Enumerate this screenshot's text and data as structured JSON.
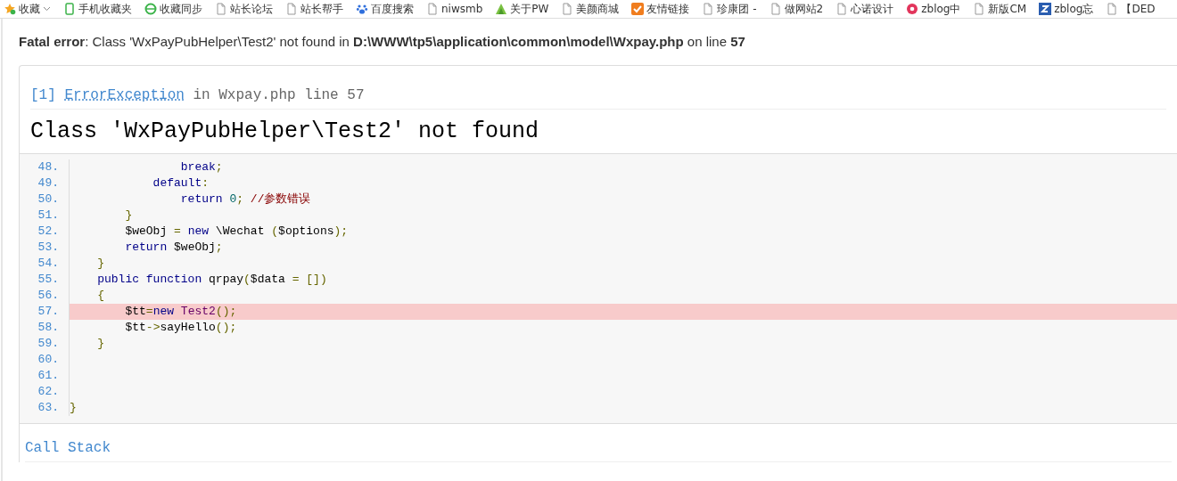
{
  "bookmarks": [
    {
      "kind": "star",
      "label": "收藏",
      "dropdown": true
    },
    {
      "kind": "phone",
      "label": "手机收藏夹",
      "dropdown": false
    },
    {
      "kind": "sync",
      "label": "收藏同步",
      "dropdown": false
    },
    {
      "kind": "doc",
      "label": "站长论坛",
      "dropdown": false
    },
    {
      "kind": "doc",
      "label": "站长帮手",
      "dropdown": false
    },
    {
      "kind": "paw",
      "label": "百度搜索",
      "dropdown": false
    },
    {
      "kind": "doc",
      "label": "niwsmb",
      "dropdown": false
    },
    {
      "kind": "leaf",
      "label": "关于PW",
      "dropdown": false
    },
    {
      "kind": "doc",
      "label": "美颜商城",
      "dropdown": false
    },
    {
      "kind": "check",
      "label": "友情链接",
      "dropdown": false
    },
    {
      "kind": "doc",
      "label": "珍康团 -",
      "dropdown": false
    },
    {
      "kind": "doc",
      "label": "做网站2",
      "dropdown": false
    },
    {
      "kind": "doc",
      "label": "心诺设计",
      "dropdown": false
    },
    {
      "kind": "flower",
      "label": "zblog中",
      "dropdown": false
    },
    {
      "kind": "doc",
      "label": "新版CM",
      "dropdown": false
    },
    {
      "kind": "z",
      "label": "zblog忘",
      "dropdown": false
    },
    {
      "kind": "doc",
      "label": "【DED",
      "dropdown": false
    }
  ],
  "fatal_error": "**Fatal error**: Class 'WxPayPubHelper\\Test2' not found in **D:\\WWW\\tp5\\application\\common\\model\\Wxpay.php** on line **57**",
  "exception": {
    "index": "[1]",
    "type": "ErrorException",
    "location": "in Wxpay.php line 57",
    "message": "Class 'WxPayPubHelper\\Test2' not found"
  },
  "code": {
    "lines": [
      {
        "number": "48.",
        "highlighted": false,
        "tokens": [
          {
            "kind": "keyword",
            "text": "                break"
          },
          {
            "kind": "punct",
            "text": ";"
          }
        ]
      },
      {
        "number": "49.",
        "highlighted": false,
        "tokens": [
          {
            "kind": "keyword",
            "text": "            default"
          },
          {
            "kind": "punct",
            "text": ":"
          }
        ]
      },
      {
        "number": "50.",
        "highlighted": false,
        "tokens": [
          {
            "kind": "keyword",
            "text": "                return "
          },
          {
            "kind": "number",
            "text": "0"
          },
          {
            "kind": "punct",
            "text": "; "
          },
          {
            "kind": "comment",
            "text": "//参数错误"
          }
        ]
      },
      {
        "number": "51.",
        "highlighted": false,
        "tokens": [
          {
            "kind": "punct",
            "text": "        }"
          }
        ]
      },
      {
        "number": "52.",
        "highlighted": false,
        "tokens": [
          {
            "kind": "plain",
            "text": "        $weObj "
          },
          {
            "kind": "punct",
            "text": "= "
          },
          {
            "kind": "keyword",
            "text": "new "
          },
          {
            "kind": "plain",
            "text": "\\Wechat "
          },
          {
            "kind": "punct",
            "text": "("
          },
          {
            "kind": "plain",
            "text": "$options"
          },
          {
            "kind": "punct",
            "text": ");"
          }
        ]
      },
      {
        "number": "53.",
        "highlighted": false,
        "tokens": [
          {
            "kind": "keyword",
            "text": "        return "
          },
          {
            "kind": "plain",
            "text": "$weObj"
          },
          {
            "kind": "punct",
            "text": ";"
          }
        ]
      },
      {
        "number": "54.",
        "highlighted": false,
        "tokens": [
          {
            "kind": "punct",
            "text": "    }"
          }
        ]
      },
      {
        "number": "55.",
        "highlighted": false,
        "tokens": [
          {
            "kind": "keyword",
            "text": "    public function "
          },
          {
            "kind": "plain",
            "text": "qrpay"
          },
          {
            "kind": "punct",
            "text": "("
          },
          {
            "kind": "plain",
            "text": "$data "
          },
          {
            "kind": "punct",
            "text": "= [])"
          }
        ]
      },
      {
        "number": "56.",
        "highlighted": false,
        "tokens": [
          {
            "kind": "punct",
            "text": "    {"
          }
        ]
      },
      {
        "number": "57.",
        "highlighted": true,
        "tokens": [
          {
            "kind": "plain",
            "text": "        $tt"
          },
          {
            "kind": "punct",
            "text": "="
          },
          {
            "kind": "keyword",
            "text": "new "
          },
          {
            "kind": "type",
            "text": "Test2"
          },
          {
            "kind": "punct",
            "text": "();"
          }
        ]
      },
      {
        "number": "58.",
        "highlighted": false,
        "tokens": [
          {
            "kind": "plain",
            "text": "        $tt"
          },
          {
            "kind": "punct",
            "text": "->"
          },
          {
            "kind": "plain",
            "text": "sayHello"
          },
          {
            "kind": "punct",
            "text": "();"
          }
        ]
      },
      {
        "number": "59.",
        "highlighted": false,
        "tokens": [
          {
            "kind": "punct",
            "text": "    }"
          }
        ]
      },
      {
        "number": "60.",
        "highlighted": false
      },
      {
        "number": "61.",
        "highlighted": false
      },
      {
        "number": "62.",
        "highlighted": false
      },
      {
        "number": "63.",
        "highlighted": false,
        "tokens": [
          {
            "kind": "punct",
            "text": "}"
          }
        ]
      }
    ]
  },
  "call_stack": {
    "title": "Call Stack"
  }
}
